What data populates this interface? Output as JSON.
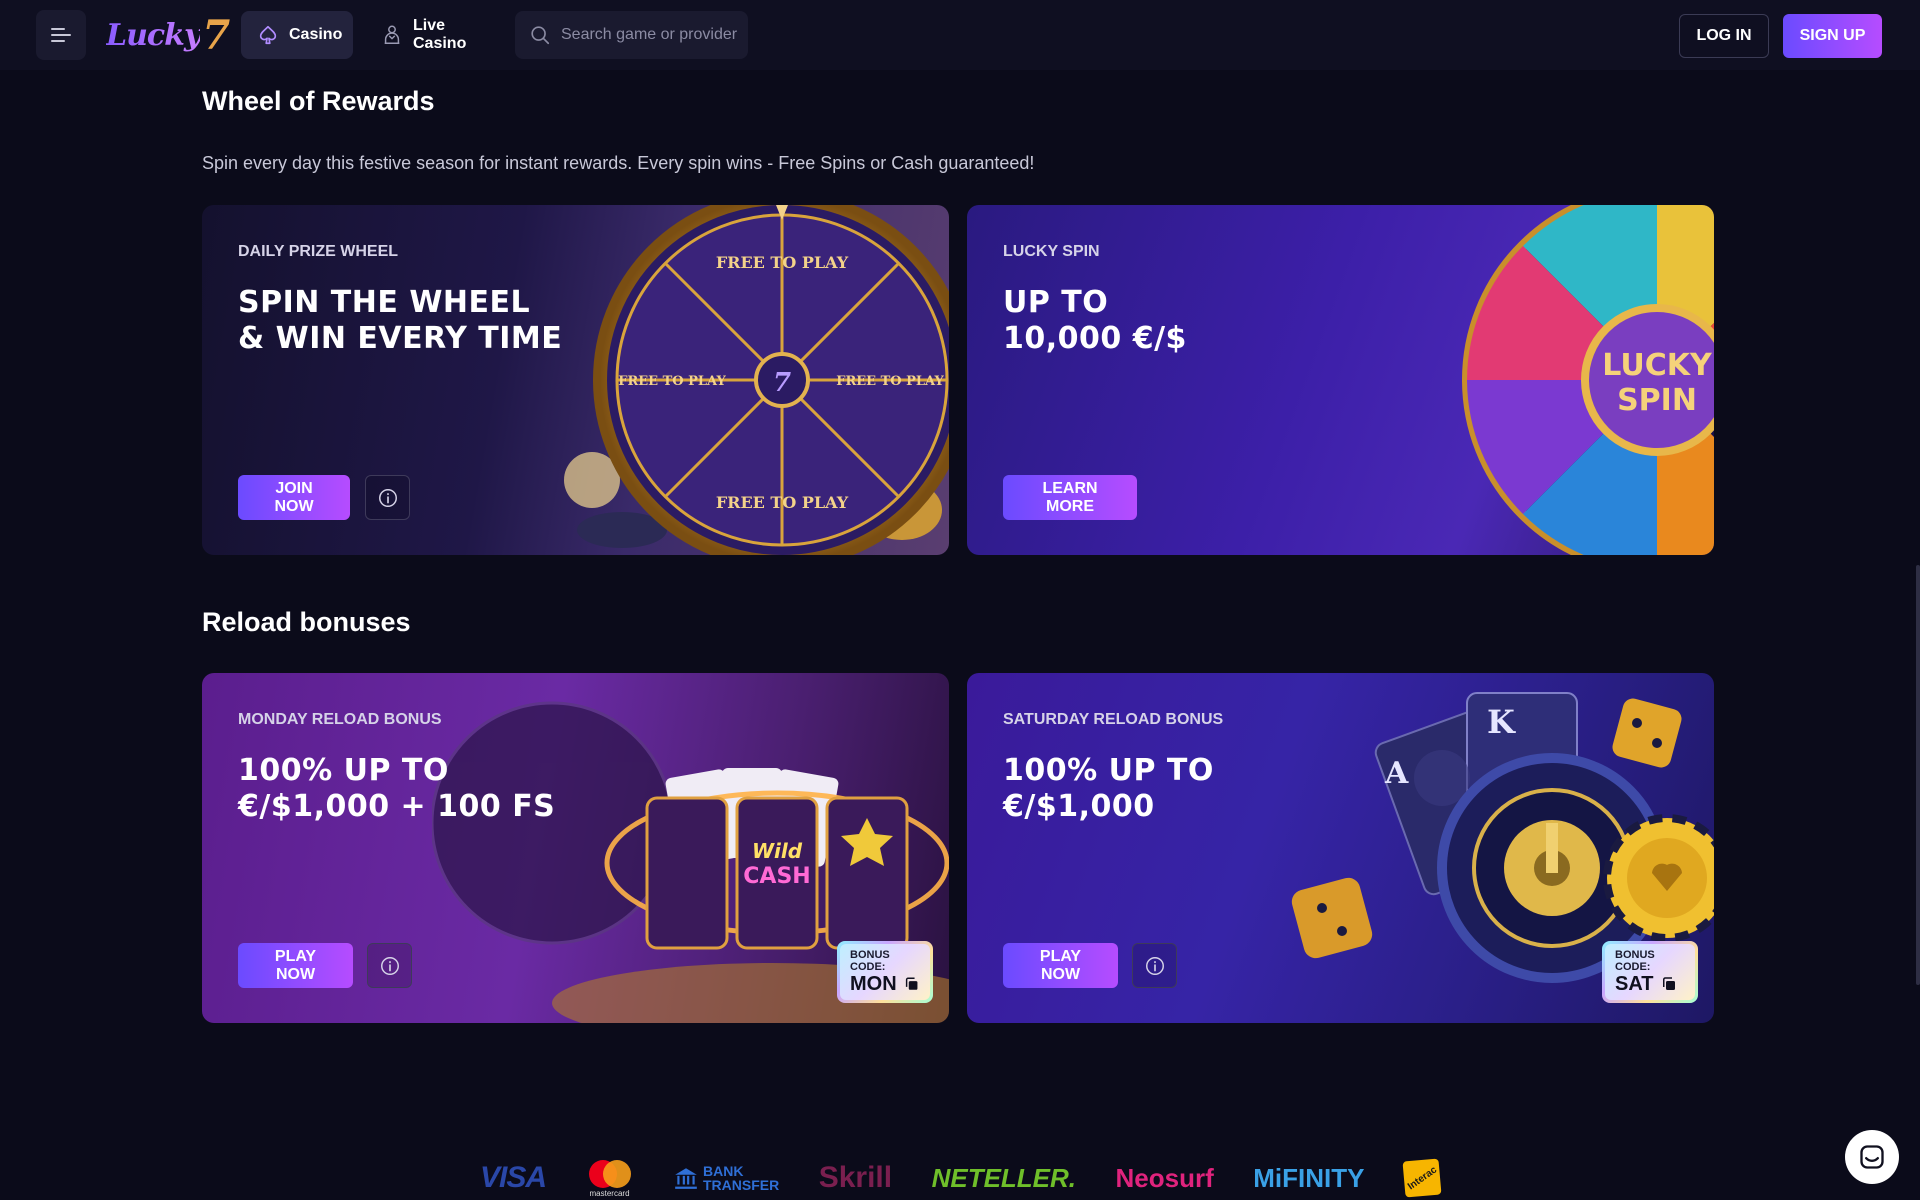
{
  "header": {
    "logo_text": "Lucky",
    "logo_mark": "7",
    "nav": [
      {
        "label": "Casino",
        "icon": "spade-icon",
        "active": true
      },
      {
        "label": "Live Casino",
        "icon": "dealer-icon",
        "active": false
      }
    ],
    "search_placeholder": "Search game or provider",
    "login_label": "LOG IN",
    "signup_label": "SIGN UP"
  },
  "wheel_section": {
    "title": "Wheel of Rewards",
    "description": "Spin every day this festive season for instant rewards. Every spin wins - Free Spins or Cash guaranteed!",
    "cards": [
      {
        "label": "DAILY PRIZE WHEEL",
        "headline_line1": "SPIN THE WHEEL",
        "headline_line2": "& WIN EVERY TIME",
        "cta": "JOIN NOW",
        "wheel_text": "FREE TO PLAY"
      },
      {
        "label": "LUCKY SPIN",
        "headline_line1": "UP TO",
        "headline_line2": "10,000 €/$",
        "cta": "LEARN MORE",
        "wheel_center_line1": "LUCKY",
        "wheel_center_line2": "SPIN"
      }
    ]
  },
  "reload_section": {
    "title": "Reload bonuses",
    "cards": [
      {
        "label": "MONDAY RELOAD BONUS",
        "headline_line1": "100% UP TO",
        "headline_line2": "€/$1,000 + 100 FS",
        "cta": "PLAY NOW",
        "bonus_caption": "BONUS CODE:",
        "bonus_code": "MON",
        "slot_text_line1": "Wild",
        "slot_text_line2": "CASH"
      },
      {
        "label": "SATURDAY RELOAD BONUS",
        "headline_line1": "100% UP TO",
        "headline_line2": "€/$1,000",
        "cta": "PLAY NOW",
        "bonus_caption": "BONUS CODE:",
        "bonus_code": "SAT",
        "card_letter_k": "K",
        "card_letter_a": "A"
      }
    ]
  },
  "payments": [
    {
      "name": "VISA",
      "color": "#2a47a8"
    },
    {
      "name": "mastercard",
      "color": "#eb001b"
    },
    {
      "name_line1": "BANK",
      "name_line2": "TRANSFER",
      "color": "#2f6fd6"
    },
    {
      "name": "Skrill",
      "color": "#7a1f4f"
    },
    {
      "name": "NETELLER.",
      "color": "#6fbf2a"
    },
    {
      "name": "Neosurf",
      "color": "#e0237d"
    },
    {
      "name": "MiFINITY",
      "color": "#3aa1e6"
    },
    {
      "name": "Interac",
      "color": "#f7b500"
    }
  ],
  "colors": {
    "accent_gradient_start": "#6b4bff",
    "accent_gradient_end": "#b64cff",
    "background": "#0b0b1a",
    "header": "#0f0f21"
  }
}
